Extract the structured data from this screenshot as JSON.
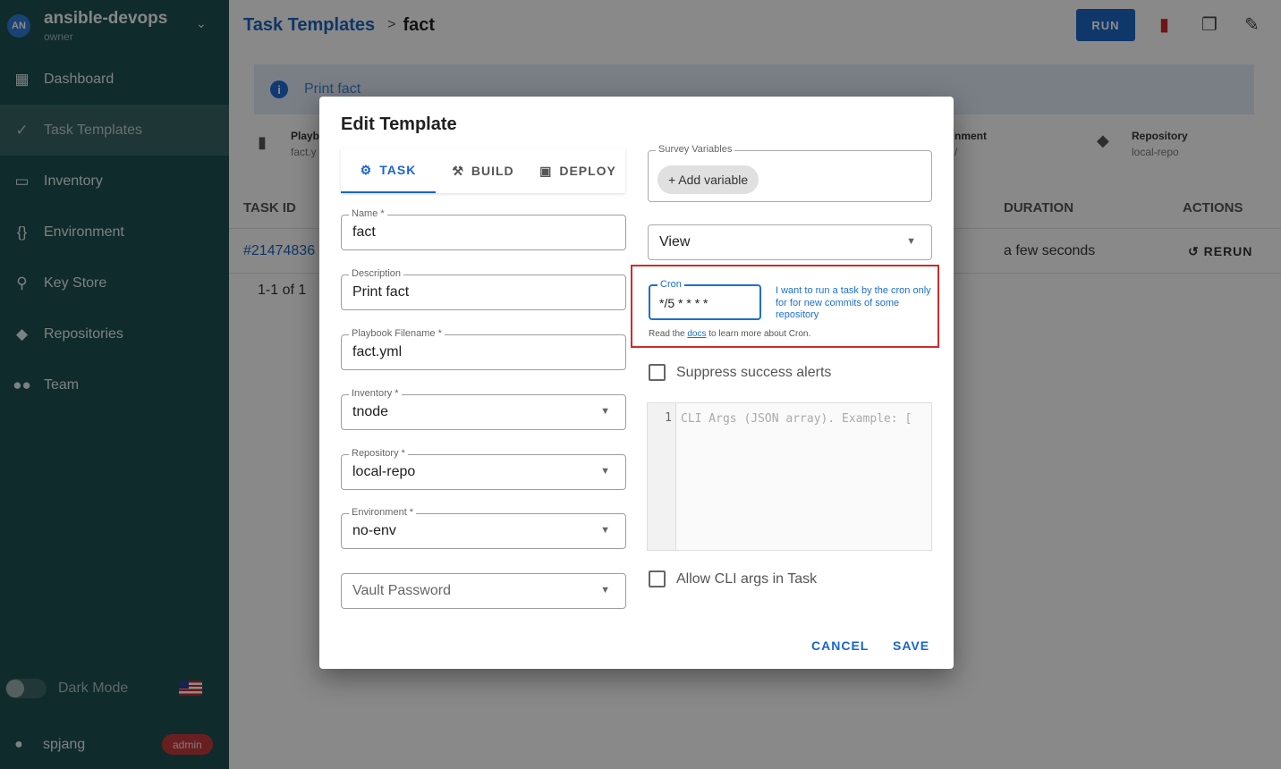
{
  "sidebar": {
    "avatar": "AN",
    "project_name": "ansible-devops",
    "project_role": "owner",
    "items": [
      {
        "label": "Dashboard",
        "icon": "dashboard-icon"
      },
      {
        "label": "Task Templates",
        "icon": "checks-icon"
      },
      {
        "label": "Inventory",
        "icon": "monitor-icon"
      },
      {
        "label": "Environment",
        "icon": "braces-icon"
      },
      {
        "label": "Key Store",
        "icon": "key-icon"
      },
      {
        "label": "Repositories",
        "icon": "git-icon"
      },
      {
        "label": "Team",
        "icon": "people-icon"
      }
    ],
    "dark_mode_label": "Dark Mode",
    "user_name": "spjang",
    "user_badge": "admin"
  },
  "header": {
    "breadcrumb_link": "Task Templates",
    "breadcrumb_current": "fact",
    "run_label": "RUN"
  },
  "main": {
    "info_text": "Print fact",
    "meta": [
      {
        "title": "Playb",
        "value": "fact.y"
      },
      {
        "title": "nment",
        "value": "/"
      },
      {
        "title": "Repository",
        "value": "local-repo"
      }
    ],
    "columns": [
      "TASK ID",
      "DURATION",
      "ACTIONS"
    ],
    "row": {
      "task_id": "#21474836",
      "duration": "a few seconds",
      "action": "RERUN"
    },
    "pagination": "1-1 of 1"
  },
  "dialog": {
    "title": "Edit Template",
    "tabs": [
      {
        "label": "TASK",
        "icon": "gear-icon"
      },
      {
        "label": "BUILD",
        "icon": "wrench-icon"
      },
      {
        "label": "DEPLOY",
        "icon": "deploy-icon"
      }
    ],
    "fields": {
      "name_label": "Name *",
      "name_value": "fact",
      "description_label": "Description",
      "description_value": "Print fact",
      "playbook_label": "Playbook Filename *",
      "playbook_value": "fact.yml",
      "inventory_label": "Inventory *",
      "inventory_value": "tnode",
      "repository_label": "Repository *",
      "repository_value": "local-repo",
      "environment_label": "Environment *",
      "environment_value": "no-env",
      "vault_placeholder": "Vault Password"
    },
    "survey_label": "Survey Variables",
    "add_variable": "+ Add variable",
    "view_value": "View",
    "cron": {
      "label": "Cron",
      "value": "*/5 * * * *",
      "hint": "I want to run a task by the cron only for for new commits of some repository",
      "read_prefix": "Read the",
      "docs_link": "docs",
      "read_suffix": "to learn more about Cron."
    },
    "suppress_label": "Suppress success alerts",
    "cli_line": "1",
    "cli_placeholder": "CLI Args (JSON array). Example: [",
    "allow_cli_label": "Allow CLI args in Task",
    "cancel_label": "CANCEL",
    "save_label": "SAVE"
  },
  "colors": {
    "sidebar_bg": "#1d4f4f",
    "accent": "#1a63d0",
    "danger": "#d12a2a"
  }
}
